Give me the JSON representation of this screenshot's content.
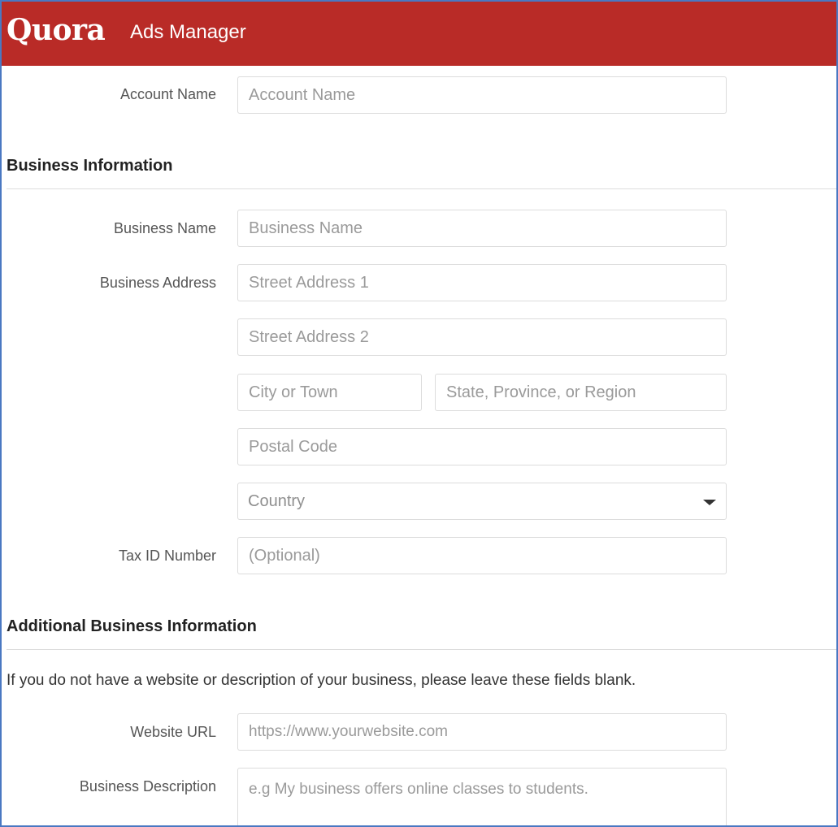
{
  "header": {
    "logo_text": "Quora",
    "app_title": "Ads Manager",
    "background_color": "#b92b27"
  },
  "account": {
    "name_label": "Account Name",
    "name_placeholder": "Account Name",
    "name_value": ""
  },
  "business_info": {
    "section_title": "Business Information",
    "name_label": "Business Name",
    "name_placeholder": "Business Name",
    "address_label": "Business Address",
    "street1_placeholder": "Street Address 1",
    "street2_placeholder": "Street Address 2",
    "city_placeholder": "City or Town",
    "state_placeholder": "State, Province, or Region",
    "postal_placeholder": "Postal Code",
    "country_selected": "Country",
    "country_icon": "chevron-down-icon",
    "tax_label": "Tax ID Number",
    "tax_placeholder": "(Optional)"
  },
  "additional_info": {
    "section_title": "Additional Business Information",
    "note": "If you do not have a website or description of your business, please leave these fields blank.",
    "website_label": "Website URL",
    "website_placeholder": "https://www.yourwebsite.com",
    "description_label": "Business Description",
    "description_placeholder": "e.g My business offers online classes to students."
  }
}
